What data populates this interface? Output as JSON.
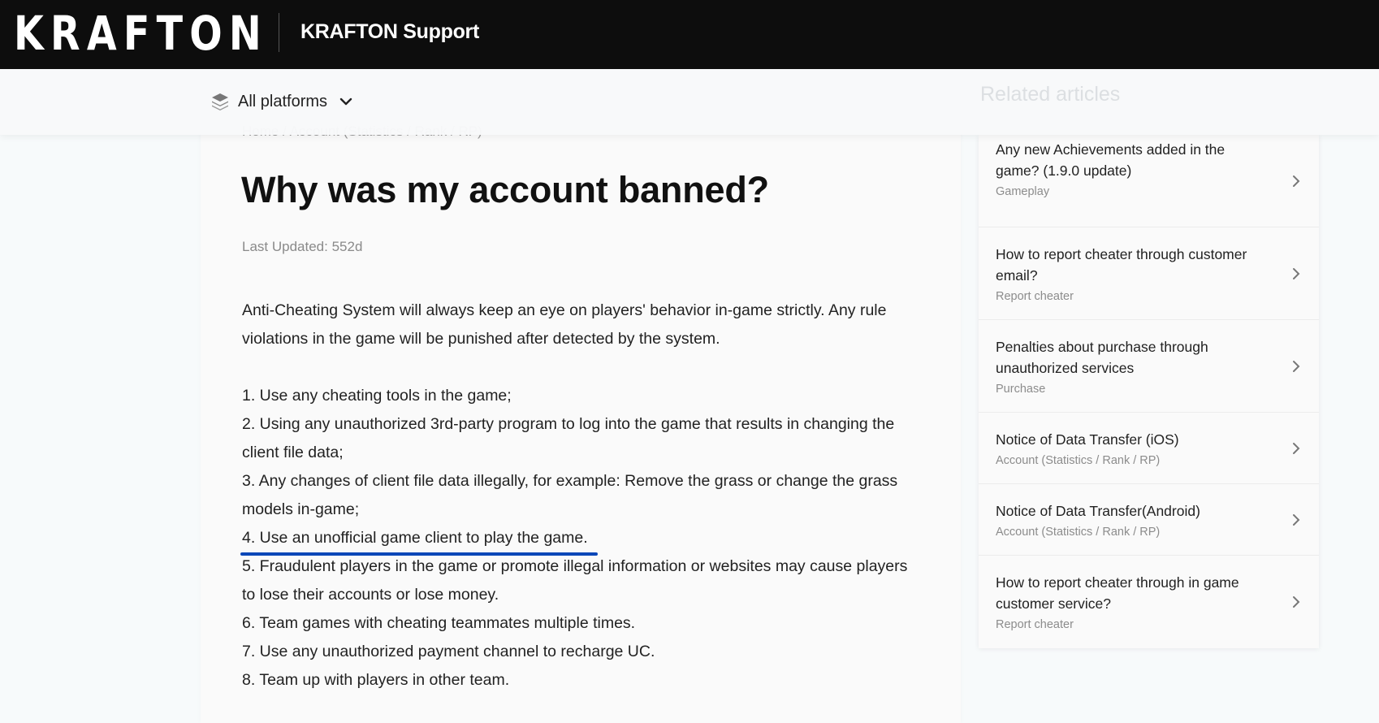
{
  "header": {
    "logo_text": "KRAFTON",
    "site_title": "KRAFTON Support"
  },
  "subbar": {
    "platform_label": "All platforms",
    "platform_icon": "layers-icon",
    "related_title": "Related articles"
  },
  "article": {
    "breadcrumb": [
      "Home",
      "Account (Statistics / Rank / RP)"
    ],
    "breadcrumb_sep": " / ",
    "title": "Why was my account banned?",
    "last_updated": "Last Updated: 552d",
    "intro": "Anti-Cheating System will always keep an eye on players' behavior in-game strictly. Any rule violations in the game will be punished after detected by the system.",
    "items": [
      "1. Use any cheating tools in the game;",
      "2. Using any unauthorized 3rd-party program to log into the game that results in changing the client file data;",
      "3. Any changes of client file data illegally, for example: Remove the grass or change the grass models in-game;",
      "4. Use an unofficial game client to play the game.",
      "5. Fraudulent players in the game or promote illegal information or websites may cause players to lose their accounts or lose money.",
      "6. Team games with cheating teammates multiple times.",
      "7. Use any unauthorized payment channel to recharge UC.",
      "8. Team up with players in other team."
    ],
    "highlighted_item_index": 3,
    "highlight_color": "#0b47b8"
  },
  "related": [
    {
      "title": "Any new Achievements added in the game? (1.9.0 update)",
      "category": "Gameplay"
    },
    {
      "title": "How to report cheater through customer email?",
      "category": "Report cheater"
    },
    {
      "title": "Penalties about purchase through unauthorized services",
      "category": "Purchase"
    },
    {
      "title": "Notice of Data Transfer (iOS)",
      "category": "Account (Statistics / Rank / RP)"
    },
    {
      "title": "Notice of Data Transfer(Android)",
      "category": "Account (Statistics / Rank / RP)"
    },
    {
      "title": "How to report cheater through in game customer service?",
      "category": "Report cheater"
    }
  ]
}
